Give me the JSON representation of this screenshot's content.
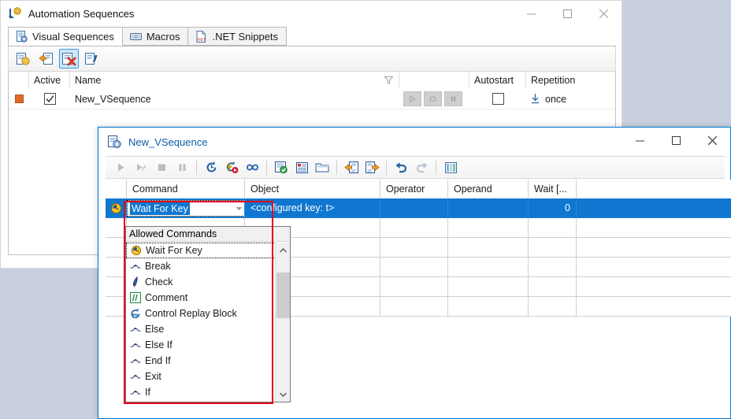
{
  "back_window": {
    "title": "Automation Sequences",
    "title_icon": "automation-sequences-icon",
    "controls": {
      "minimize": "—",
      "maximize": "□",
      "close": "✕"
    },
    "tabs": [
      {
        "label": "Visual Sequences",
        "icon": "visual-sequences-icon",
        "active": true
      },
      {
        "label": "Macros",
        "icon": "macros-icon",
        "active": false
      },
      {
        "label": ".NET Snippets",
        "icon": "dotnet-snippets-icon",
        "active": false
      }
    ],
    "toolbar": [
      {
        "name": "new-sequence-button",
        "icon": "new-sequence-icon",
        "selected": false
      },
      {
        "name": "import-sequence-button",
        "icon": "import-sequence-icon",
        "selected": false
      },
      {
        "name": "delete-sequence-button",
        "icon": "delete-sequence-icon",
        "selected": true
      },
      {
        "name": "edit-sequence-button",
        "icon": "edit-sequence-icon",
        "selected": false
      }
    ],
    "grid": {
      "columns": [
        "",
        "Active",
        "Name",
        "",
        "",
        "Autostart",
        "Repetition"
      ],
      "sort_indicator": "filter-icon",
      "rows": [
        {
          "status_icon": "stop-marker-icon",
          "active": true,
          "name": "New_VSequence",
          "play": "play-icon",
          "stop": "stop-icon",
          "pause": "pause-icon",
          "autostart": false,
          "repetition": "once",
          "repetition_icon": "download-arrow-icon"
        }
      ]
    }
  },
  "front_window": {
    "title": "New_VSequence",
    "title_icon": "vsequence-icon",
    "controls": {
      "minimize": "—",
      "maximize": "□",
      "close": "✕"
    },
    "toolbar": [
      {
        "name": "run-button",
        "icon": "play-icon"
      },
      {
        "name": "step-button",
        "icon": "step-icon"
      },
      {
        "name": "stop-button",
        "icon": "stop-square-icon"
      },
      {
        "name": "pause-button",
        "icon": "pause-icon"
      },
      {
        "name": "separator-1",
        "icon": "separator"
      },
      {
        "name": "replay-button",
        "icon": "replay-circle-icon"
      },
      {
        "name": "fast-replay-button",
        "icon": "fast-replay-icon"
      },
      {
        "name": "loop-button",
        "icon": "infinity-icon"
      },
      {
        "name": "separator-2",
        "icon": "separator"
      },
      {
        "name": "validate-button",
        "icon": "validate-check-icon"
      },
      {
        "name": "properties-button",
        "icon": "properties-icon"
      },
      {
        "name": "open-folder-button",
        "icon": "folder-icon"
      },
      {
        "name": "separator-3",
        "icon": "separator"
      },
      {
        "name": "import-button",
        "icon": "import-icon"
      },
      {
        "name": "export-button",
        "icon": "export-icon"
      },
      {
        "name": "separator-4",
        "icon": "separator"
      },
      {
        "name": "undo-button",
        "icon": "undo-icon"
      },
      {
        "name": "redo-button",
        "icon": "redo-icon"
      },
      {
        "name": "separator-5",
        "icon": "separator"
      },
      {
        "name": "columns-button",
        "icon": "columns-icon"
      }
    ],
    "grid": {
      "columns": [
        "",
        "Command",
        "Object",
        "Operator",
        "Operand",
        "Wait [...",
        ""
      ],
      "rows": [
        {
          "selected": true,
          "row_icon": "wait-clock-icon",
          "command": "Wait For Key",
          "object": "<configured key: t>",
          "operator": "",
          "operand": "",
          "wait": "0",
          "extra": ""
        },
        {
          "selected": false,
          "row_icon": "",
          "command": "",
          "object": "",
          "operator": "",
          "operand": "",
          "wait": "",
          "extra": ""
        },
        {
          "selected": false,
          "row_icon": "",
          "command": "",
          "object": "",
          "operator": "",
          "operand": "",
          "wait": "",
          "extra": ""
        },
        {
          "selected": false,
          "row_icon": "",
          "command": "",
          "object": "",
          "operator": "",
          "operand": "",
          "wait": "",
          "extra": ""
        },
        {
          "selected": false,
          "row_icon": "",
          "command": "",
          "object": "",
          "operator": "",
          "operand": "",
          "wait": "",
          "extra": ""
        }
      ]
    },
    "combo_editor": {
      "value": "Wait For Key",
      "dropdown_arrow": "chevron-down-icon"
    }
  },
  "dropdown": {
    "header": "Allowed Commands",
    "items": [
      {
        "label": "Wait For Key",
        "icon": "wait-clock-icon",
        "focused": true
      },
      {
        "label": "Break",
        "icon": "flow-node-icon",
        "focused": false
      },
      {
        "label": "Check",
        "icon": "check-pen-icon",
        "focused": false
      },
      {
        "label": "Comment",
        "icon": "comment-icon",
        "focused": false
      },
      {
        "label": "Control Replay Block",
        "icon": "control-replay-icon",
        "focused": false
      },
      {
        "label": "Else",
        "icon": "flow-node-icon",
        "focused": false
      },
      {
        "label": "Else If",
        "icon": "flow-node-icon",
        "focused": false
      },
      {
        "label": "End If",
        "icon": "flow-node-icon",
        "focused": false
      },
      {
        "label": "Exit",
        "icon": "flow-node-icon",
        "focused": false
      },
      {
        "label": "If",
        "icon": "flow-node-icon",
        "focused": false
      }
    ],
    "scrollbar": {
      "up_arrow": "chevron-up-icon",
      "down_arrow": "chevron-down-icon"
    }
  },
  "colors": {
    "desktop_background": "#c8d0e0",
    "selection_blue": "#0f77d0",
    "accent_border": "#0078d7",
    "highlight_red": "#e3001b",
    "title_link_blue": "#0b5ea8"
  }
}
